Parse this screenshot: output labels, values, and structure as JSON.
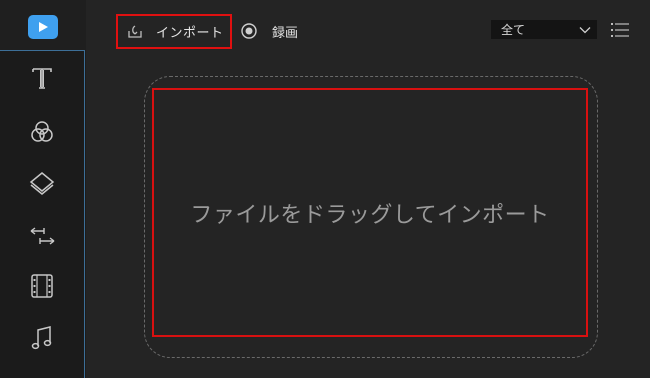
{
  "toolbar": {
    "import_label": "インポート",
    "record_label": "録画",
    "filter_value": "全て"
  },
  "drop_zone": {
    "message": "ファイルをドラッグしてインポート"
  },
  "rail": {
    "items": [
      {
        "icon": "media-icon"
      },
      {
        "icon": "text-icon"
      },
      {
        "icon": "filters-icon"
      },
      {
        "icon": "overlays-icon"
      },
      {
        "icon": "transitions-icon"
      },
      {
        "icon": "elements-icon"
      },
      {
        "icon": "music-icon"
      }
    ]
  },
  "colors": {
    "accent": "#3fa0ef",
    "highlight": "#e01010",
    "rail_border": "#3d6f98",
    "background": "#242424"
  }
}
